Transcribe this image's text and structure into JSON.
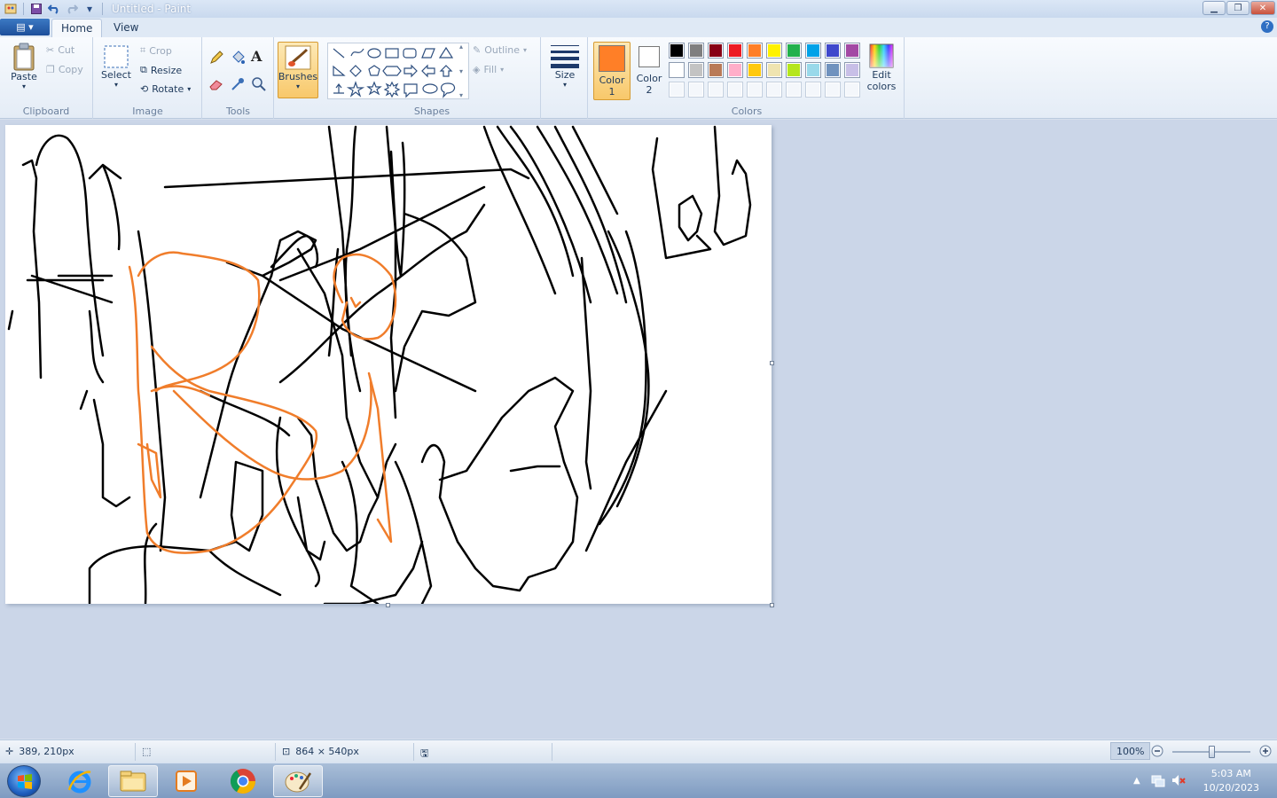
{
  "window": {
    "title": "Untitled - Paint"
  },
  "tabs": [
    {
      "label": "Home",
      "active": true
    },
    {
      "label": "View",
      "active": false
    }
  ],
  "ribbon": {
    "clipboard": {
      "label": "Clipboard",
      "paste": "Paste",
      "cut": "Cut",
      "copy": "Copy"
    },
    "image": {
      "label": "Image",
      "select": "Select",
      "crop": "Crop",
      "resize": "Resize",
      "rotate": "Rotate"
    },
    "tools": {
      "label": "Tools"
    },
    "brushes": {
      "label": "Brushes"
    },
    "shapes": {
      "label": "Shapes",
      "outline": "Outline",
      "fill": "Fill"
    },
    "size": {
      "label": "Size"
    },
    "colors": {
      "label": "Colors",
      "color1_label": "Color",
      "color1_num": "1",
      "color2_label": "Color",
      "color2_num": "2",
      "color1": "#ff7f27",
      "color2": "#ffffff",
      "edit_line1": "Edit",
      "edit_line2": "colors",
      "palette_row1": [
        "#000000",
        "#7f7f7f",
        "#880015",
        "#ed1c24",
        "#ff7f27",
        "#fff200",
        "#22b14c",
        "#00a2e8",
        "#3f48cc",
        "#a349a4"
      ],
      "palette_row2": [
        "#ffffff",
        "#c3c3c3",
        "#b97a57",
        "#ffaec9",
        "#ffc90e",
        "#efe4b0",
        "#b5e61d",
        "#99d9ea",
        "#7092be",
        "#c8bfe7"
      ]
    }
  },
  "status": {
    "cursor_pos": "389, 210px",
    "canvas_size": "864 × 540px",
    "zoom": "100%",
    "zoom_level": 1.0
  },
  "taskbar": {
    "apps": [
      "internet-explorer",
      "file-explorer",
      "media-player",
      "chrome",
      "paint"
    ],
    "active_app": "paint",
    "time": "5:03 AM",
    "date": "10/20/2023"
  }
}
